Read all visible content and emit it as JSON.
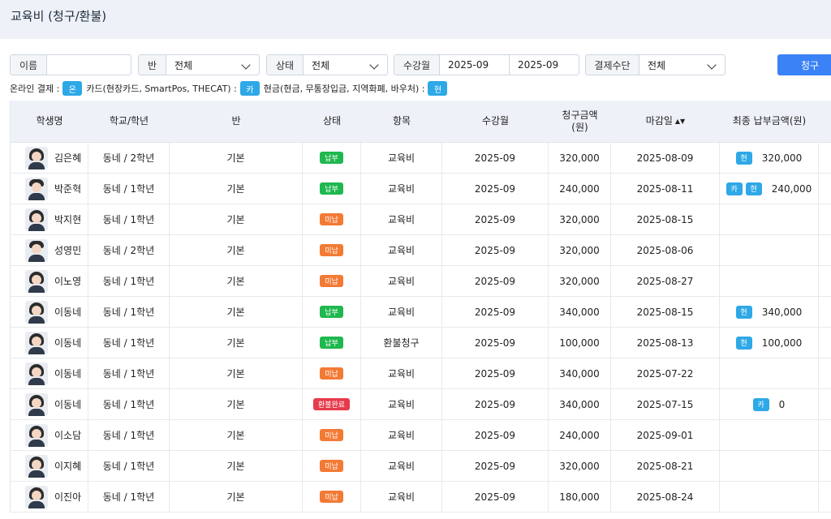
{
  "header": {
    "title": "교육비 (청구/환불)"
  },
  "filters": {
    "name": {
      "label": "이름",
      "value": "",
      "placeholder": ""
    },
    "class": {
      "label": "반",
      "value": "전체"
    },
    "status": {
      "label": "상태",
      "value": "전체"
    },
    "period": {
      "label": "수강월",
      "from": "2025-09",
      "to": "2025-09"
    },
    "payment": {
      "label": "결제수단",
      "value": "전체"
    },
    "submit_label": "청구"
  },
  "legend": {
    "online_label": "온라인 결제 :",
    "online_tag": "온",
    "card_label": "카드(현장카드, SmartPos, THECAT) :",
    "card_tag": "카",
    "cash_label": "현금(현금, 무통장입금, 지역화폐, 바우처) :",
    "cash_tag": "현"
  },
  "table": {
    "columns": {
      "student": "학생명",
      "school": "학교/학년",
      "class": "반",
      "status": "상태",
      "item": "항목",
      "month": "수강월",
      "amount_line1": "청구금액",
      "amount_line2": "(원)",
      "due": "마감일",
      "sort_icon": "▲▼",
      "paid": "최종 납부금액(원)"
    },
    "rows": [
      {
        "name": "김은혜",
        "school": "동네 / 2학년",
        "class": "기본",
        "status": "납부",
        "status_type": "paid",
        "item": "교육비",
        "month": "2025-09",
        "amount": "320,000",
        "due": "2025-08-09",
        "pay_tags": [
          "현"
        ],
        "paid": "320,000",
        "avatar": "girl"
      },
      {
        "name": "박준혁",
        "school": "동네 / 1학년",
        "class": "기본",
        "status": "납부",
        "status_type": "paid",
        "item": "교육비",
        "month": "2025-09",
        "amount": "240,000",
        "due": "2025-08-11",
        "pay_tags": [
          "카",
          "현"
        ],
        "paid": "240,000",
        "avatar": "boy"
      },
      {
        "name": "박지현",
        "school": "동네 / 1학년",
        "class": "기본",
        "status": "미납",
        "status_type": "unpaid",
        "item": "교육비",
        "month": "2025-09",
        "amount": "320,000",
        "due": "2025-08-15",
        "pay_tags": [],
        "paid": "",
        "avatar": "girl"
      },
      {
        "name": "성영민",
        "school": "동네 / 2학년",
        "class": "기본",
        "status": "미납",
        "status_type": "unpaid",
        "item": "교육비",
        "month": "2025-09",
        "amount": "320,000",
        "due": "2025-08-06",
        "pay_tags": [],
        "paid": "",
        "avatar": "boy"
      },
      {
        "name": "이노영",
        "school": "동네 / 1학년",
        "class": "기본",
        "status": "미납",
        "status_type": "unpaid",
        "item": "교육비",
        "month": "2025-09",
        "amount": "320,000",
        "due": "2025-08-27",
        "pay_tags": [],
        "paid": "",
        "avatar": "girl"
      },
      {
        "name": "이동네",
        "school": "동네 / 1학년",
        "class": "기본",
        "status": "납부",
        "status_type": "paid",
        "item": "교육비",
        "month": "2025-09",
        "amount": "340,000",
        "due": "2025-08-15",
        "pay_tags": [
          "현"
        ],
        "paid": "340,000",
        "avatar": "girl"
      },
      {
        "name": "이동네",
        "school": "동네 / 1학년",
        "class": "기본",
        "status": "납부",
        "status_type": "paid",
        "item": "환불청구",
        "month": "2025-09",
        "amount": "100,000",
        "due": "2025-08-13",
        "pay_tags": [
          "현"
        ],
        "paid": "100,000",
        "avatar": "girl"
      },
      {
        "name": "이동네",
        "school": "동네 / 1학년",
        "class": "기본",
        "status": "미납",
        "status_type": "unpaid",
        "item": "교육비",
        "month": "2025-09",
        "amount": "340,000",
        "due": "2025-07-22",
        "pay_tags": [],
        "paid": "",
        "avatar": "girl"
      },
      {
        "name": "이동네",
        "school": "동네 / 1학년",
        "class": "기본",
        "status": "환불완료",
        "status_type": "refund",
        "item": "교육비",
        "month": "2025-09",
        "amount": "340,000",
        "due": "2025-07-15",
        "pay_tags": [
          "카"
        ],
        "paid": "0",
        "avatar": "girl"
      },
      {
        "name": "이소담",
        "school": "동네 / 1학년",
        "class": "기본",
        "status": "미납",
        "status_type": "unpaid",
        "item": "교육비",
        "month": "2025-09",
        "amount": "240,000",
        "due": "2025-09-01",
        "pay_tags": [],
        "paid": "",
        "avatar": "girl"
      },
      {
        "name": "이지혜",
        "school": "동네 / 1학년",
        "class": "기본",
        "status": "미납",
        "status_type": "unpaid",
        "item": "교육비",
        "month": "2025-09",
        "amount": "320,000",
        "due": "2025-08-21",
        "pay_tags": [],
        "paid": "",
        "avatar": "girl"
      },
      {
        "name": "이진아",
        "school": "동네 / 1학년",
        "class": "기본",
        "status": "미납",
        "status_type": "unpaid",
        "item": "교육비",
        "month": "2025-09",
        "amount": "180,000",
        "due": "2025-08-24",
        "pay_tags": [],
        "paid": "",
        "avatar": "girl"
      }
    ]
  }
}
